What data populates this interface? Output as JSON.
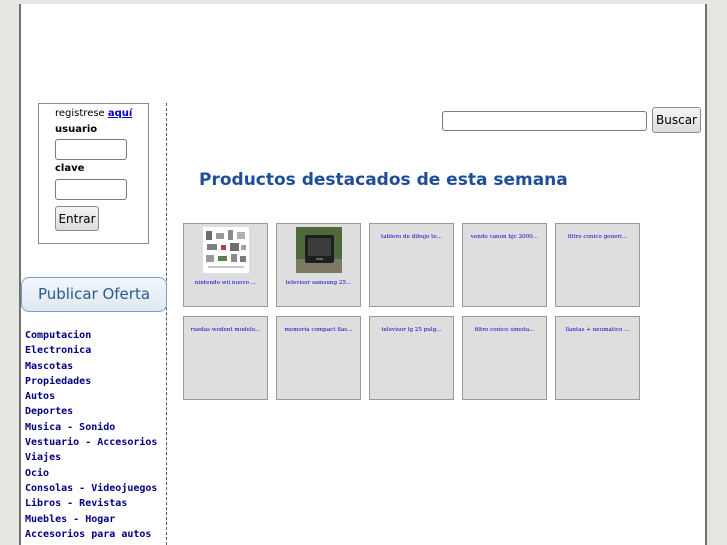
{
  "login": {
    "register_prefix": "registrese ",
    "register_link": "aquí",
    "user_label": "usuario",
    "password_label": "clave",
    "submit_label": "Entrar"
  },
  "publish_button": "Publicar Oferta",
  "categories": [
    "Computacion",
    "Electronica",
    "Mascotas",
    "Propiedades",
    "Autos",
    "Deportes",
    "Musica - Sonido",
    "Vestuario - Accesorios",
    "Viajes",
    "Ocio",
    "Consolas - Videojuegos",
    "Libros - Revistas",
    "Muebles - Hogar",
    "Accesorios para autos"
  ],
  "search": {
    "value": "",
    "button_label": "Buscar"
  },
  "heading": "Productos destacados de esta semana",
  "products": [
    {
      "caption": "nintendo wii nuevo ...",
      "thumb": "catalog-thumbnail"
    },
    {
      "caption": "televisor samsung 25...",
      "thumb": "tv-thumbnail"
    },
    {
      "caption": "tablero de dibujo te...",
      "thumb": ""
    },
    {
      "caption": "vendo canon bjc 2000...",
      "thumb": ""
    },
    {
      "caption": "filtro conico generi...",
      "thumb": ""
    },
    {
      "caption": "ruedas wodent modelo...",
      "thumb": ""
    },
    {
      "caption": "memoria compact flas...",
      "thumb": ""
    },
    {
      "caption": "televisor lg 25 pulg...",
      "thumb": ""
    },
    {
      "caption": "filtro conico simota...",
      "thumb": ""
    },
    {
      "caption": "llantas + neumatico ...",
      "thumb": ""
    }
  ],
  "colors": {
    "heading": "#1f4e99",
    "category_text": "#000080",
    "link": "#0000cc",
    "card_bg": "#dedede"
  }
}
